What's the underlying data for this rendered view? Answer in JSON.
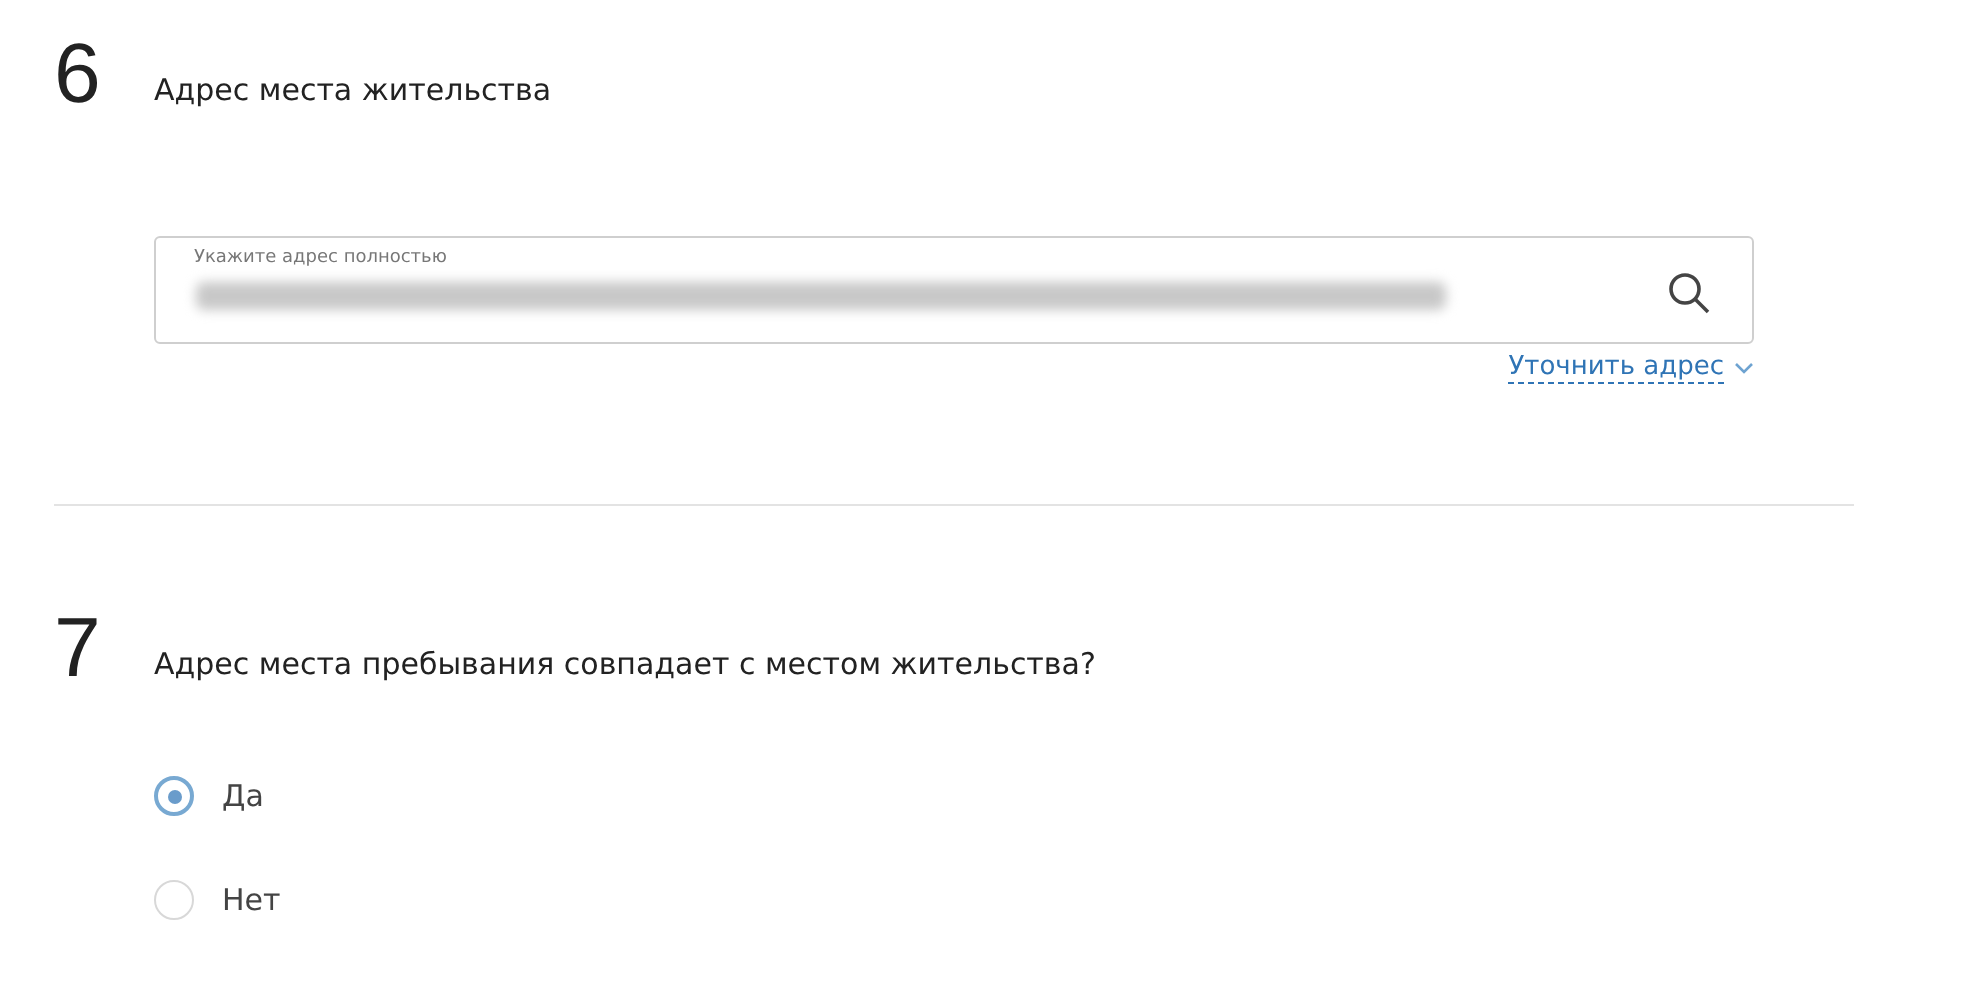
{
  "sections": [
    {
      "number": "6",
      "title": "Адрес места жительства",
      "kind": "address",
      "field": {
        "label": "Укажите адрес полностью",
        "value_blurred": true
      },
      "link": "Уточнить адрес"
    },
    {
      "number": "7",
      "title": "Адрес места пребывания совпадает с местом жительства?",
      "kind": "radio",
      "options": [
        {
          "label": "Да",
          "selected": true
        },
        {
          "label": "Нет",
          "selected": false
        }
      ]
    }
  ]
}
